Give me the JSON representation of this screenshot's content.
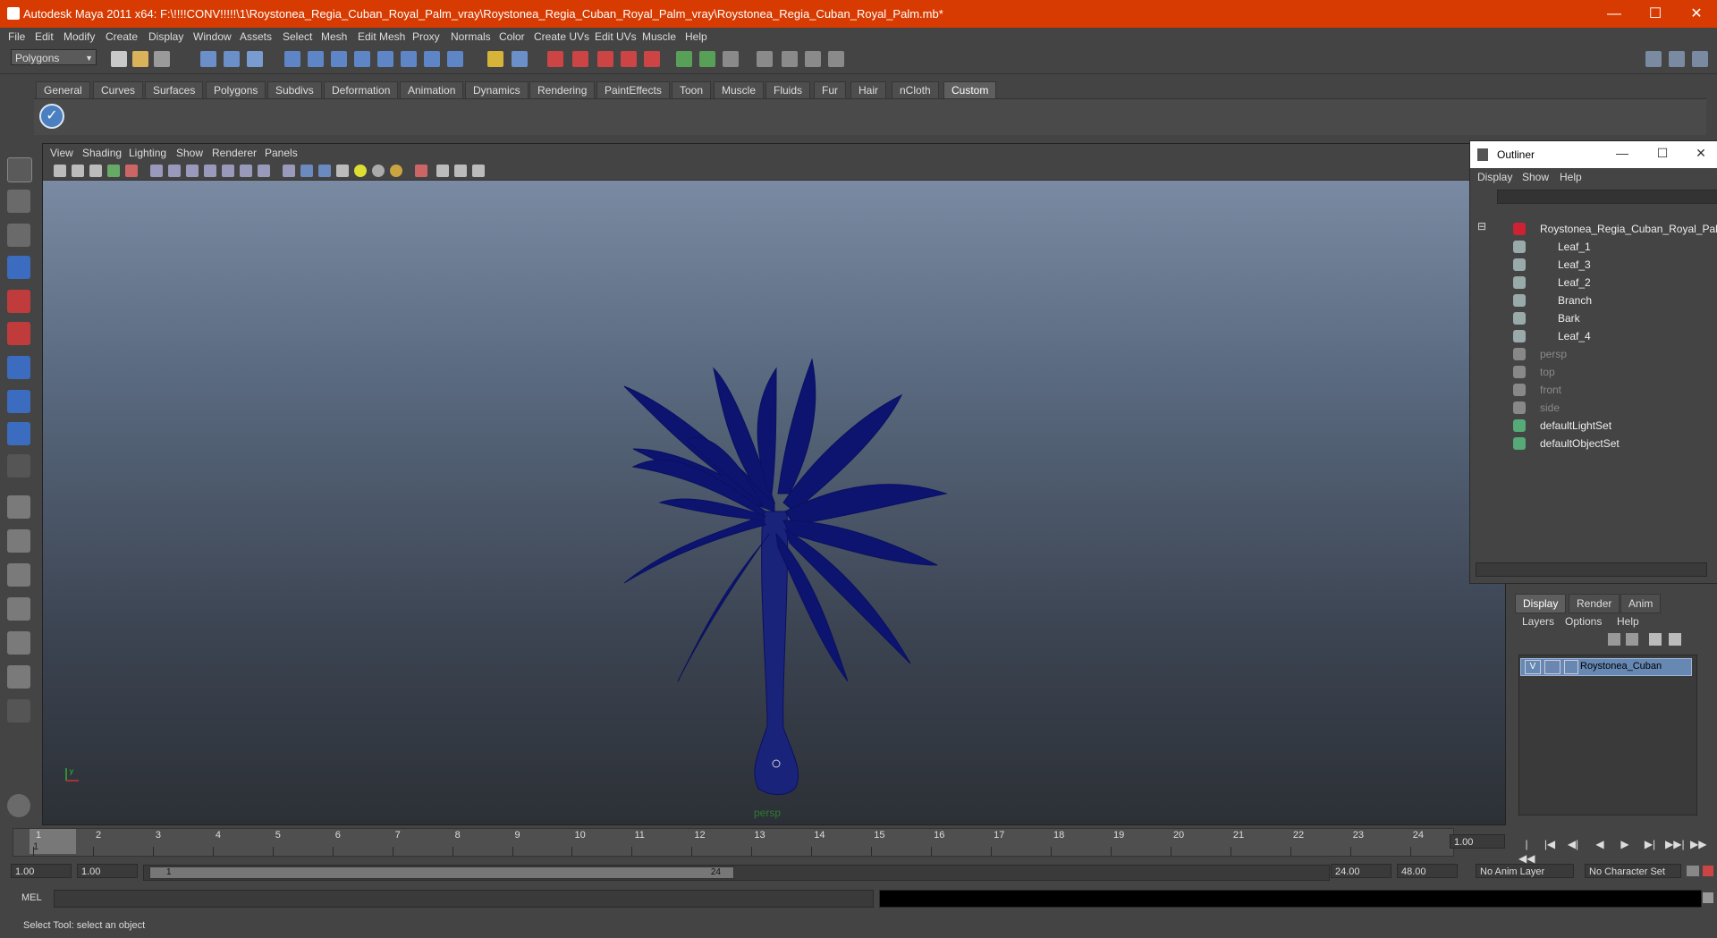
{
  "window": {
    "title": "Autodesk Maya 2011 x64: F:\\!!!!CONV!!!!!\\1\\Roystonea_Regia_Cuban_Royal_Palm_vray\\Roystonea_Regia_Cuban_Royal_Palm_vray\\Roystonea_Regia_Cuban_Royal_Palm.mb*",
    "minimize": "—",
    "maximize": "☐",
    "close": "✕"
  },
  "menubar": [
    "File",
    "Edit",
    "Modify",
    "Create",
    "Display",
    "Window",
    "Assets",
    "Select",
    "Mesh",
    "Edit Mesh",
    "Proxy",
    "Normals",
    "Color",
    "Create UVs",
    "Edit UVs",
    "Muscle",
    "Help"
  ],
  "statusline": {
    "mode": "Polygons"
  },
  "shelf": {
    "tabs": [
      "General",
      "Curves",
      "Surfaces",
      "Polygons",
      "Subdivs",
      "Deformation",
      "Animation",
      "Dynamics",
      "Rendering",
      "PaintEffects",
      "Toon",
      "Muscle",
      "Fluids",
      "Fur",
      "Hair",
      "nCloth",
      "Custom"
    ],
    "active_tab": "Custom"
  },
  "viewport": {
    "menu": [
      "View",
      "Shading",
      "Lighting",
      "Show",
      "Renderer",
      "Panels"
    ],
    "camera_label": "persp",
    "model_color": "#0c1470"
  },
  "outliner": {
    "title": "Outliner",
    "menu": [
      "Display",
      "Show",
      "Help"
    ],
    "collapse_glyph": "⊟",
    "items": [
      {
        "label": "Roystonea_Regia_Cuban_Royal_Palm",
        "depth": 0,
        "dim": false,
        "icon": "transform-icon"
      },
      {
        "label": "Leaf_1",
        "depth": 1,
        "dim": false,
        "icon": "mesh-icon"
      },
      {
        "label": "Leaf_3",
        "depth": 1,
        "dim": false,
        "icon": "mesh-icon"
      },
      {
        "label": "Leaf_2",
        "depth": 1,
        "dim": false,
        "icon": "mesh-icon"
      },
      {
        "label": "Branch",
        "depth": 1,
        "dim": false,
        "icon": "mesh-icon"
      },
      {
        "label": "Bark",
        "depth": 1,
        "dim": false,
        "icon": "mesh-icon"
      },
      {
        "label": "Leaf_4",
        "depth": 1,
        "dim": false,
        "icon": "mesh-icon"
      },
      {
        "label": "persp",
        "depth": 0,
        "dim": true,
        "icon": "camera-icon"
      },
      {
        "label": "top",
        "depth": 0,
        "dim": true,
        "icon": "camera-icon"
      },
      {
        "label": "front",
        "depth": 0,
        "dim": true,
        "icon": "camera-icon"
      },
      {
        "label": "side",
        "depth": 0,
        "dim": true,
        "icon": "camera-icon"
      },
      {
        "label": "defaultLightSet",
        "depth": 0,
        "dim": false,
        "icon": "set-icon"
      },
      {
        "label": "defaultObjectSet",
        "depth": 0,
        "dim": false,
        "icon": "set-icon"
      }
    ]
  },
  "layer_editor": {
    "tabs": [
      "Display",
      "Render",
      "Anim"
    ],
    "active_tab": "Display",
    "menu": [
      "Layers",
      "Options",
      "Help"
    ],
    "layer": {
      "visible": "V",
      "name": "Roystonea_Cuban"
    }
  },
  "timeline": {
    "ticks": [
      "1",
      "2",
      "3",
      "4",
      "5",
      "6",
      "7",
      "8",
      "9",
      "10",
      "11",
      "12",
      "13",
      "14",
      "15",
      "16",
      "17",
      "18",
      "19",
      "20",
      "21",
      "22",
      "23",
      "24"
    ],
    "current_frame": "1",
    "current_frame_field": "1.00",
    "playback": [
      "|◀◀",
      "|◀",
      "◀|",
      "◀",
      "▶",
      "▶|",
      "▶▶|",
      "▶▶"
    ]
  },
  "range": {
    "start": "1.00",
    "playback_start": "1.00",
    "bar_start": "1",
    "bar_end": "24",
    "playback_end": "24.00",
    "end": "48.00",
    "anim_layer": "No Anim Layer",
    "character_set": "No Character Set"
  },
  "commandline": {
    "label": "MEL"
  },
  "helpline": {
    "text": "Select Tool: select an object"
  }
}
